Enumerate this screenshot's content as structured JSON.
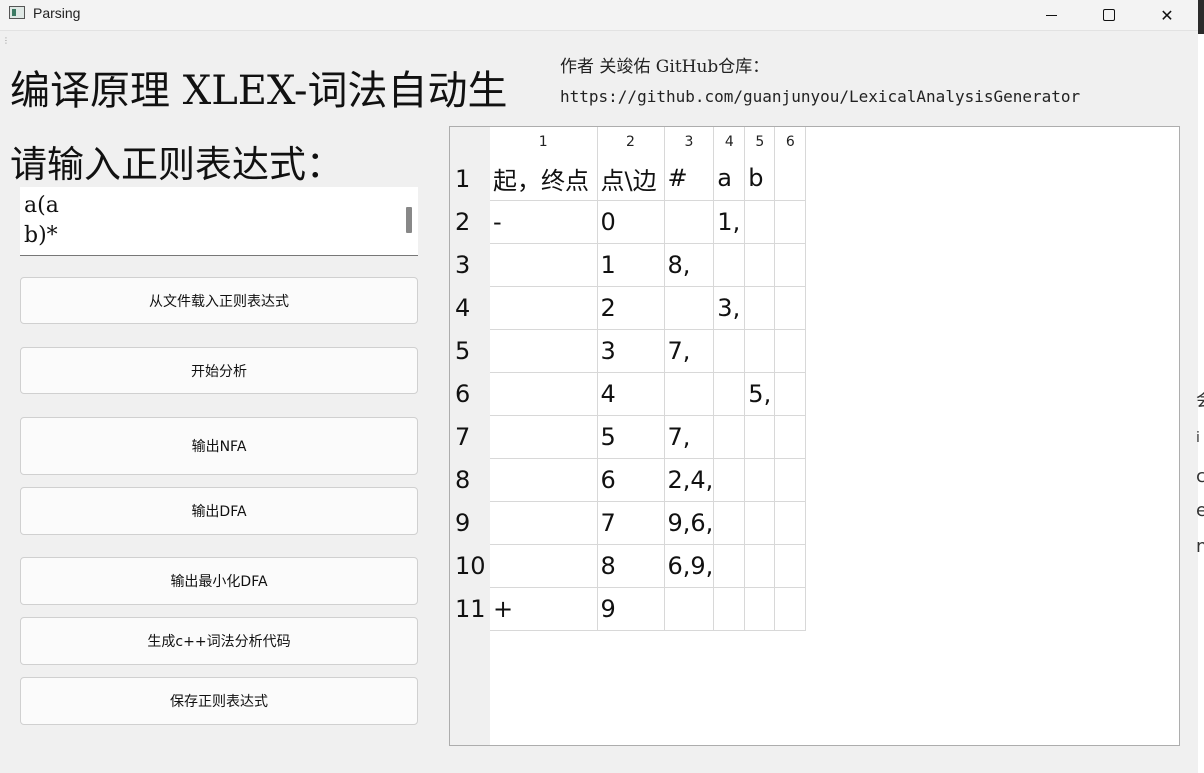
{
  "window": {
    "title": "Parsing",
    "controls": {
      "minimize": "",
      "maximize": "",
      "close": "✕"
    }
  },
  "header": {
    "main_title": "编译原理 XLEX-词法自动生",
    "author_line": "作者 关竣佑 GitHub仓库：",
    "repo_url": "https://github.com/guanjunyou/LexicalAnalysisGenerator"
  },
  "input": {
    "label": "请输入正则表达式：",
    "regex_value": "a(a\nb)*"
  },
  "buttons": [
    "从文件载入正则表达式",
    "开始分析",
    "输出NFA",
    "输出DFA",
    "输出最小化DFA",
    "生成c++词法分析代码",
    "保存正则表达式"
  ],
  "table": {
    "column_headers": [
      "1",
      "2",
      "3",
      "4",
      "5",
      "6"
    ],
    "row_headers": [
      "1",
      "2",
      "3",
      "4",
      "5",
      "6",
      "7",
      "8",
      "9",
      "10",
      "11"
    ],
    "rows": [
      [
        "起，终点",
        "点\\边",
        "#",
        "a",
        "b",
        ""
      ],
      [
        "-",
        "0",
        "",
        "1,",
        "",
        ""
      ],
      [
        "",
        "1",
        "8,",
        "",
        "",
        ""
      ],
      [
        "",
        "2",
        "",
        "3,",
        "",
        ""
      ],
      [
        "",
        "3",
        "7,",
        "",
        "",
        ""
      ],
      [
        "",
        "4",
        "",
        "",
        "5,",
        ""
      ],
      [
        "",
        "5",
        "7,",
        "",
        "",
        ""
      ],
      [
        "",
        "6",
        "2,4,",
        "",
        "",
        ""
      ],
      [
        "",
        "7",
        "9,6,",
        "",
        "",
        ""
      ],
      [
        "",
        "8",
        "6,9,",
        "",
        "",
        ""
      ],
      [
        "+",
        "9",
        "",
        "",
        "",
        ""
      ]
    ]
  },
  "background_window": {
    "glyphs": [
      "会",
      "i",
      "c",
      "e",
      "n"
    ]
  }
}
